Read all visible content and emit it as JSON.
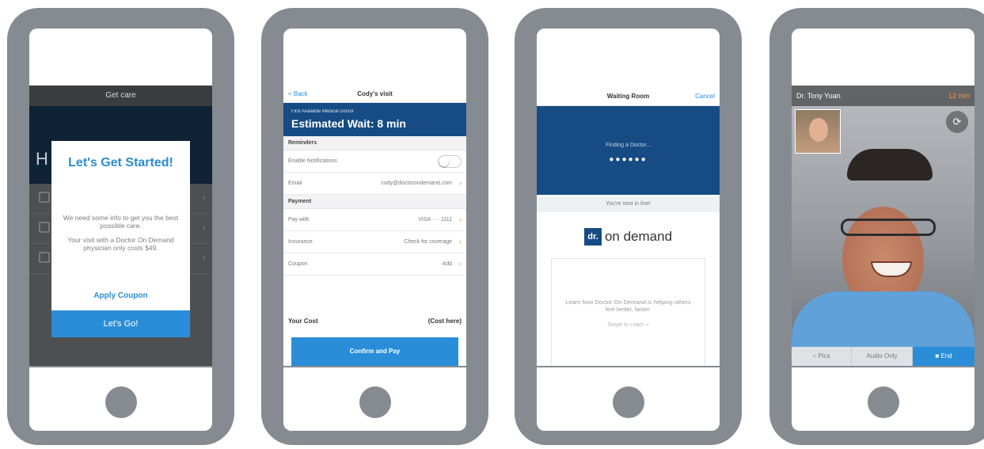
{
  "phone1": {
    "header_title": "Get care",
    "hello_partial": "H",
    "modal": {
      "title": "Let's Get Started!",
      "line1": "We need some info to get you the best possible care.",
      "line2": "Your visit with a Doctor On Demand physician only costs $49.",
      "coupon": "Apply Coupon",
      "go": "Let's Go!"
    }
  },
  "phone2": {
    "back": "< Back",
    "title": "Cody's visit",
    "banner_small": "First Available Medical Doctor",
    "banner_big": "Estimated Wait: 8 min",
    "section_reminders": "Reminders",
    "notifications": "Enable Notifications",
    "email_label": "Email",
    "email_value": "cody@doctorondemand.com",
    "section_payment": "Payment",
    "pay_with_label": "Pay with",
    "pay_with_value": "VISA ···· 1111",
    "insurance_label": "Insurance",
    "insurance_value": "Check for coverage",
    "coupon_label": "Coupon",
    "coupon_value": "Add",
    "cost_label": "Your Cost",
    "cost_value": "(Cost here)",
    "pay_button": "Confirm and Pay"
  },
  "phone3": {
    "title": "Waiting Room",
    "cancel": "Cancel",
    "finding": "Finding a Doctor...",
    "dots": "●●●●●●",
    "next": "You're next in line!",
    "logo_mark": "dr.",
    "logo_word": "on demand",
    "learn": "Learn how Doctor On Demand is helping others feel better, faster.",
    "swipe": "Swipe to Learn »"
  },
  "phone4": {
    "doctor_name": "Dr. Tony Yuan",
    "duration": "12 min",
    "pics": "○ Pics",
    "audio": "Audio Only",
    "end": "■ End",
    "accent": "#2a8dd8"
  }
}
